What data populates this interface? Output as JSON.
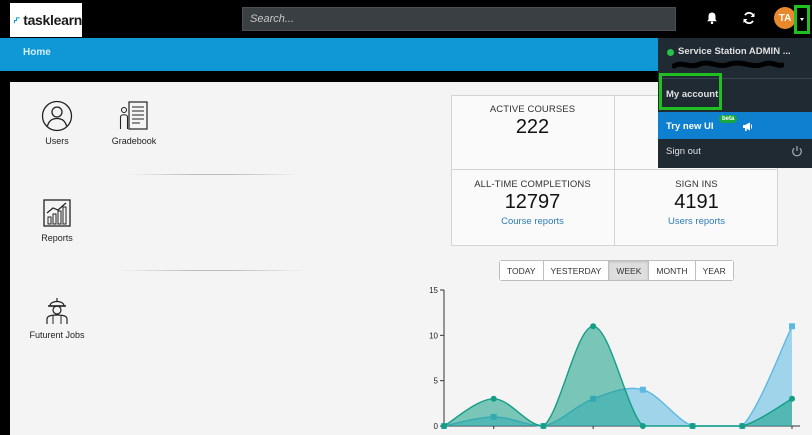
{
  "app": {
    "logo_text": "tasklearn"
  },
  "search": {
    "placeholder": "Search..."
  },
  "user": {
    "initials": "TA"
  },
  "breadcrumb": {
    "home": "Home"
  },
  "tiles": [
    {
      "label": "Users",
      "icon": "users-icon"
    },
    {
      "label": "Gradebook",
      "icon": "gradebook-icon"
    },
    {
      "label": "Reports",
      "icon": "reports-icon"
    },
    {
      "label": "Futurent Jobs",
      "icon": "worker-icon"
    }
  ],
  "stats": {
    "active_courses": {
      "label": "ACTIVE COURSES",
      "value": "222"
    },
    "completions": {
      "label": "ALL-TIME COMPLETIONS",
      "value": "12797",
      "link": "Course reports"
    },
    "signins": {
      "label": "SIGN INS",
      "value": "4191",
      "link": "Users reports"
    }
  },
  "periods": [
    "TODAY",
    "YESTERDAY",
    "WEEK",
    "MONTH",
    "YEAR"
  ],
  "active_period": "WEEK",
  "dropdown": {
    "account_name": "Service Station ADMIN ...",
    "my_account": "My account",
    "try_new_ui": "Try new UI",
    "beta": "beta",
    "sign_out": "Sign out"
  },
  "colors": {
    "brand_blue": "#0f97d6",
    "highlight_green": "#1fc01f",
    "series_teal": "#149e86",
    "series_lightblue": "#5bb9e3",
    "avatar_orange": "#e8892d"
  },
  "chart_data": {
    "type": "area",
    "ylim": [
      0,
      15
    ],
    "yticks": [
      0,
      5,
      10,
      15
    ],
    "series": [
      {
        "color": "#149e86",
        "values": [
          0,
          3,
          0,
          11,
          0,
          0,
          0,
          3
        ]
      },
      {
        "color": "#5bb9e3",
        "values": [
          0,
          1,
          0,
          3,
          4,
          0,
          0,
          11
        ]
      }
    ]
  }
}
